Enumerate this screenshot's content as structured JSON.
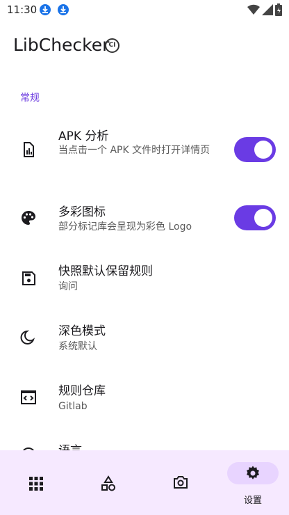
{
  "status_bar": {
    "time": "11:30",
    "notification_icons": [
      "download-icon",
      "download-icon"
    ],
    "system_icons": [
      "wifi-icon",
      "signal-icon",
      "battery-icon"
    ]
  },
  "app_bar": {
    "title": "LibChecker",
    "badge": "CI"
  },
  "section": {
    "header": "常规"
  },
  "preferences": [
    {
      "icon": "apk-analysis-icon",
      "title": "APK 分析",
      "summary": "当点击一个 APK 文件时打开详情页",
      "switch": true
    },
    {
      "icon": "palette-icon",
      "title": "多彩图标",
      "summary": "部分标记库会呈现为彩色 Logo",
      "switch": true
    },
    {
      "icon": "save-icon",
      "title": "快照默认保留规则",
      "summary": "询问"
    },
    {
      "icon": "dark-mode-icon",
      "title": "深色模式",
      "summary": "系统默认"
    },
    {
      "icon": "code-repo-icon",
      "title": "规则仓库",
      "summary": "Gitlab"
    },
    {
      "icon": "language-icon",
      "title": "语言",
      "summary": ""
    }
  ],
  "bottom_nav": {
    "items": [
      {
        "icon": "apps-grid-icon",
        "label": ""
      },
      {
        "icon": "shapes-icon",
        "label": ""
      },
      {
        "icon": "camera-icon",
        "label": ""
      },
      {
        "icon": "gear-icon",
        "label": "设置",
        "active": true
      }
    ]
  },
  "colors": {
    "accent": "#6a3be4",
    "section_header": "#6f3fe0",
    "nav_background": "#f6e9ff",
    "nav_active_pill": "#e8d4ff"
  }
}
